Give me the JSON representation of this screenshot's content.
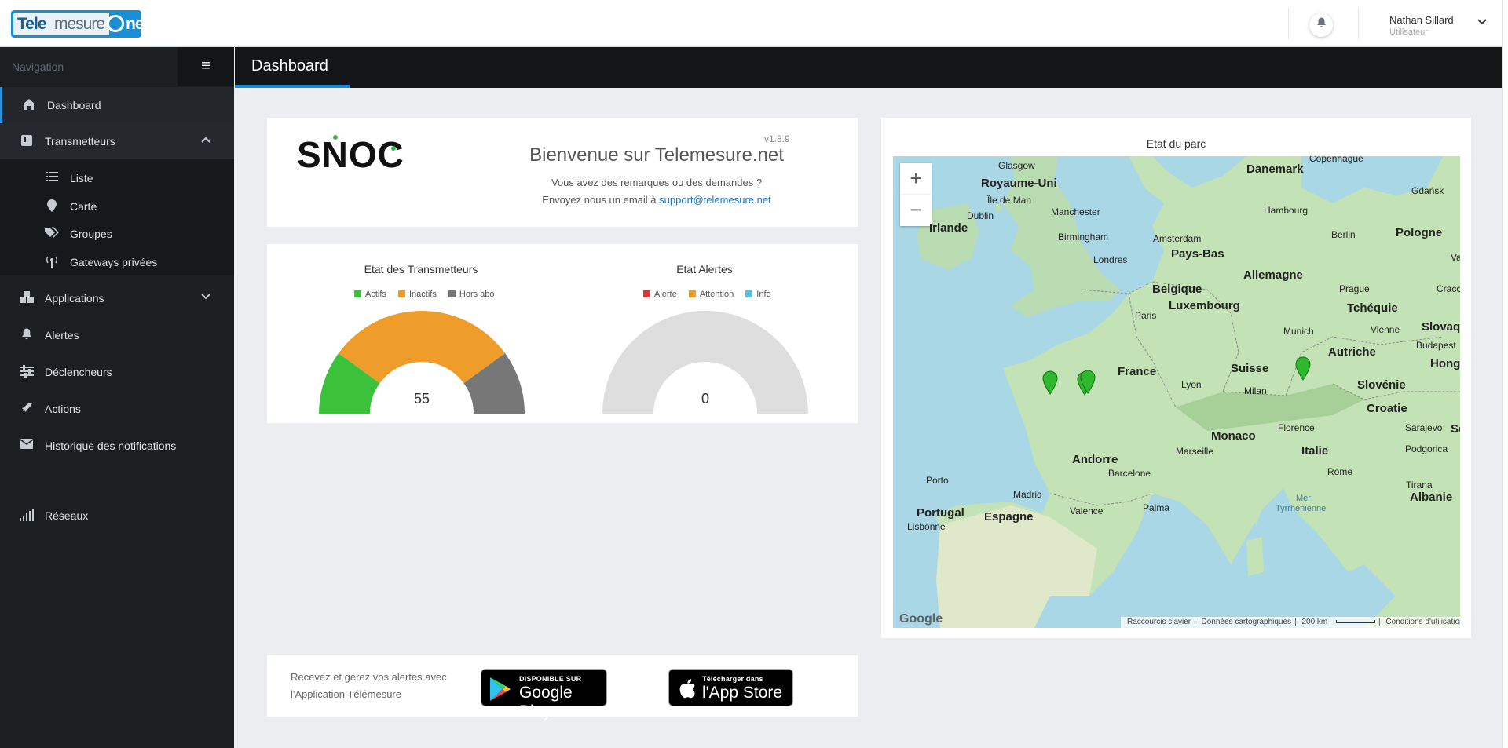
{
  "logo": {
    "part1": "Tele",
    "part2": "mesure",
    "part3": "net"
  },
  "header": {
    "user_name": "Nathan Sillard",
    "user_role": "Utilisateur"
  },
  "sidebar": {
    "title": "Navigation",
    "items": [
      {
        "label": "Dashboard"
      },
      {
        "label": "Transmetteurs"
      },
      {
        "label": "Applications"
      },
      {
        "label": "Alertes"
      },
      {
        "label": "Déclencheurs"
      },
      {
        "label": "Actions"
      },
      {
        "label": "Historique des notifications"
      },
      {
        "label": "Réseaux"
      }
    ],
    "sub_items": [
      {
        "label": "Liste"
      },
      {
        "label": "Carte"
      },
      {
        "label": "Groupes"
      },
      {
        "label": "Gateways privées"
      }
    ]
  },
  "page": {
    "title": "Dashboard"
  },
  "welcome": {
    "brand": "SNOC",
    "title": "Bienvenue sur Telemesure.net",
    "version": "v1.8.9",
    "line1": "Vous avez des remarques ou des demandes ?",
    "line2_prefix": "Envoyez nous un email à ",
    "email": "support@telemesure.net"
  },
  "gauge_transmetteurs": {
    "title": "Etat des Transmetteurs",
    "legend": [
      {
        "label": "Actifs",
        "color": "#3cc13b"
      },
      {
        "label": "Inactifs",
        "color": "#ef9d2a"
      },
      {
        "label": "Hors abo",
        "color": "#777777"
      }
    ],
    "total": "55",
    "fractions": [
      0.2,
      0.6,
      0.2
    ]
  },
  "gauge_alertes": {
    "title": "Etat Alertes",
    "legend": [
      {
        "label": "Alerte",
        "color": "#d63b3b"
      },
      {
        "label": "Attention",
        "color": "#ef9d2a"
      },
      {
        "label": "Info",
        "color": "#5bc0de"
      }
    ],
    "total": "0"
  },
  "map": {
    "title": "Etat du parc",
    "labels": {
      "glasgow": "Glasgow",
      "royaume_uni": "Royaume-Uni",
      "ile_de_man": "Île de Man",
      "dublin": "Dublin",
      "irlande": "Irlande",
      "manchester": "Manchester",
      "birmingham": "Birmingham",
      "londres": "Londres",
      "danemark": "Danemark",
      "copenhague": "Copenhague",
      "gdansk": "Gdańsk",
      "hambourg": "Hambourg",
      "amsterdam": "Amsterdam",
      "pays_bas": "Pays-Bas",
      "berlin": "Berlin",
      "pologne": "Pologne",
      "allemagne": "Allemagne",
      "belgique": "Belgique",
      "luxembourg": "Luxembourg",
      "prague": "Prague",
      "cracovie": "Craco",
      "tcheque": "Tchéquie",
      "paris": "Paris",
      "munich": "Munich",
      "vienne": "Vienne",
      "slovaquie": "Slovaqu",
      "autriche": "Autriche",
      "budapest": "Budapest",
      "france": "France",
      "suisse": "Suisse",
      "hongrie": "Hongri",
      "lyon": "Lyon",
      "milan": "Milan",
      "slovenie": "Slovénie",
      "croatie": "Croatie",
      "monaco": "Monaco",
      "florence": "Florence",
      "marseille": "Marseille",
      "andorre": "Andorre",
      "italie": "Italie",
      "sarajevo": "Sarajevo",
      "barcelone": "Barcelone",
      "porto": "Porto",
      "rome": "Rome",
      "podgorica": "Podgorica",
      "madrid": "Madrid",
      "tirana": "Tirana",
      "portugal": "Portugal",
      "albanie": "Albanie",
      "valence": "Valence",
      "palma": "Palma",
      "lisbonne": "Lisbonne",
      "espagne": "Espagne",
      "mer_tyrrhenienne": "Mer",
      "mer_tyrrhenienne2": "Tyrrhénienne",
      "varsovie_stub": "Va",
      "serbie_stub": "Se"
    },
    "footer": {
      "shortcuts": "Raccourcis clavier",
      "data": "Données cartographiques",
      "scale": "200 km",
      "terms": "Conditions d'utilisation"
    },
    "google": "Google"
  },
  "apps": {
    "text": "Recevez et gérez vos alertes avec l'Application Télémesure",
    "google_small": "DISPONIBLE SUR",
    "google_big": "Google Play",
    "apple_small": "Télécharger dans",
    "apple_big": "l'App Store"
  }
}
